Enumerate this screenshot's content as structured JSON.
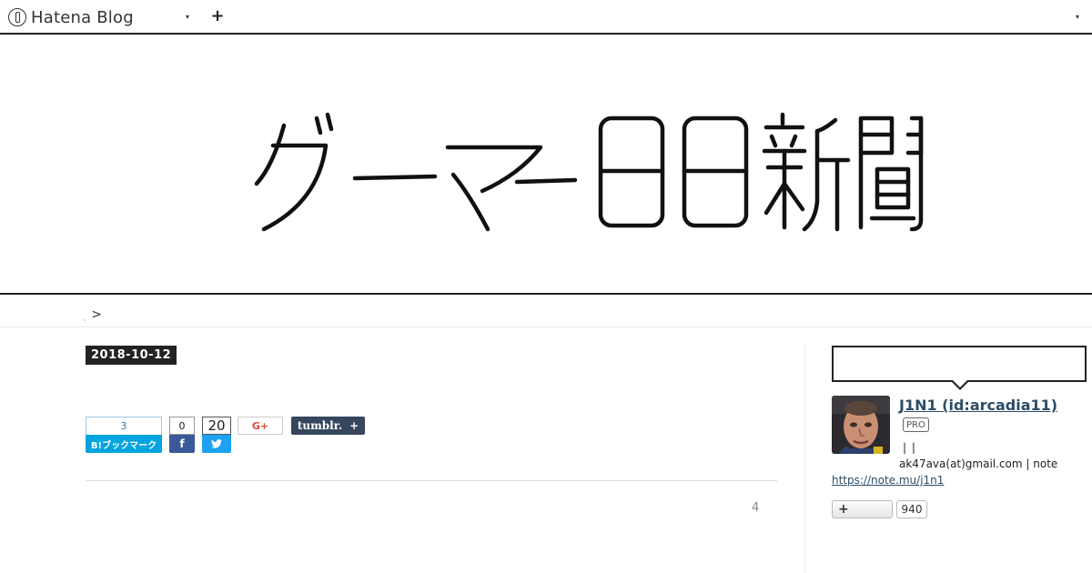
{
  "topbar": {
    "logo_text": "Hatena Blog",
    "blog_menu_icon": "▾",
    "add_icon": "+",
    "user_menu_icon": "▾"
  },
  "header": {
    "blog_title": "ゲーマー日日新聞"
  },
  "breadcrumb": {
    "home": "ˌ",
    "separator": ">"
  },
  "entry": {
    "date": "2018-10-12",
    "share": {
      "hatebu_count": "3",
      "hatebu_label": "B!ブックマーク",
      "facebook_count": "0",
      "facebook_icon": "f",
      "twitter_count": "20",
      "twitter_icon": "🐦",
      "gplus_label": "G+",
      "tumblr_label": "tumblr.",
      "tumblr_plus": "+"
    },
    "comment_count": "4"
  },
  "sidebar": {
    "profile": {
      "name": "J1N1 (id:arcadia11)",
      "badge": "PRO",
      "pipes": "| |",
      "description": "ak47ava(at)gmail.com | note",
      "link": "https://note.mu/j1n1"
    },
    "reader": {
      "button_icon": "+",
      "count": "940"
    }
  }
}
